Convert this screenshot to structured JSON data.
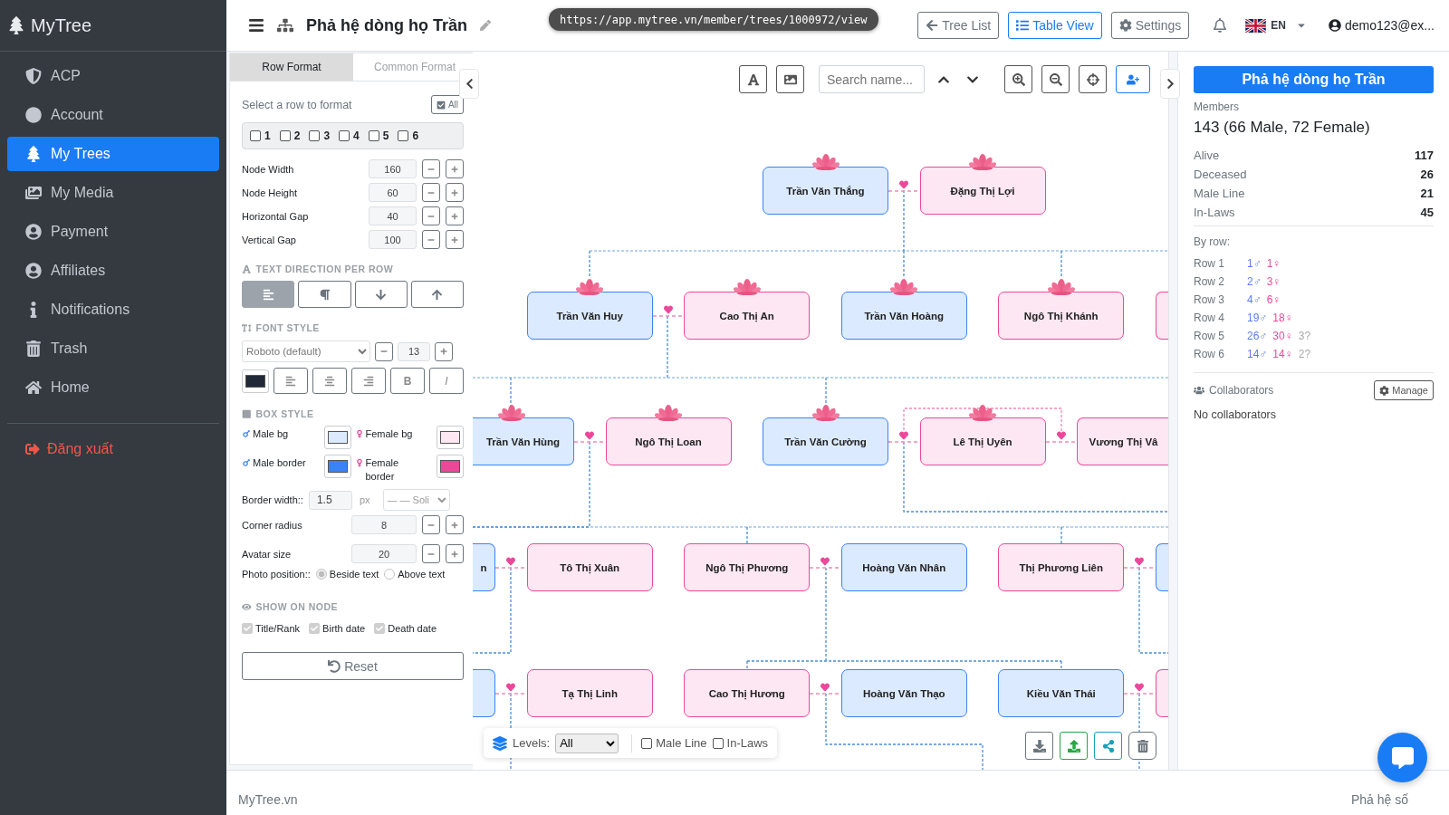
{
  "sidebar": {
    "brand": "MyTree",
    "items": [
      {
        "label": "ACP",
        "selected": false
      },
      {
        "label": "Account",
        "selected": false
      },
      {
        "label": "My Trees",
        "selected": true
      },
      {
        "label": "My Media",
        "selected": false
      },
      {
        "label": "Payment",
        "selected": false
      },
      {
        "label": "Affiliates",
        "selected": false
      },
      {
        "label": "Notifications",
        "selected": false
      },
      {
        "label": "Trash",
        "selected": false
      },
      {
        "label": "Home",
        "selected": false
      }
    ],
    "logout": "Đăng xuất"
  },
  "header": {
    "title": "Phả hệ dòng họ Trần",
    "url_tooltip": "https://app.mytree.vn/member/trees/1000972/view",
    "buttons": [
      {
        "label": "Tree List",
        "selected": false
      },
      {
        "label": "Table View",
        "selected": true
      },
      {
        "label": "Settings",
        "selected": false
      }
    ],
    "language": "EN",
    "user": "demo123@ex..."
  },
  "format_panel": {
    "tabs": [
      {
        "label": "Row Format",
        "selected": true
      },
      {
        "label": "Common Format",
        "selected": false
      }
    ],
    "row_select": {
      "label": "Select a row to format",
      "all_button": "All",
      "rows": [
        {
          "label": "1",
          "checked": false
        },
        {
          "label": "2",
          "checked": false
        },
        {
          "label": "3",
          "checked": false
        },
        {
          "label": "4",
          "checked": false
        },
        {
          "label": "5",
          "checked": false
        },
        {
          "label": "6",
          "checked": false
        }
      ]
    },
    "numeric_fields": [
      {
        "label": "Node Width",
        "value": "160"
      },
      {
        "label": "Node Height",
        "value": "60"
      },
      {
        "label": "Horizontal Gap",
        "value": "40"
      },
      {
        "label": "Vertical Gap",
        "value": "100"
      }
    ],
    "text_direction": {
      "title": "TEXT DIRECTION PER ROW",
      "options": [
        {
          "selected": true
        },
        {
          "selected": false
        },
        {
          "selected": false
        },
        {
          "selected": false
        }
      ]
    },
    "font_style": {
      "title": "FONT STYLE",
      "font": "Roboto (default)",
      "size": "13",
      "color": "#1f2937",
      "format_buttons": [
        "B",
        "I"
      ]
    },
    "box_style": {
      "title": "BOX STYLE",
      "swatches": [
        {
          "label": "Male bg",
          "kind": "male",
          "color": "#dbeafe"
        },
        {
          "label": "Female bg",
          "kind": "female",
          "color": "#fce7f3"
        },
        {
          "label": "Male border",
          "kind": "male",
          "color": "#3b82f6"
        },
        {
          "label": "Female border",
          "kind": "female",
          "color": "#ec4899"
        }
      ],
      "border_width": {
        "label": "Border width::",
        "value": "1.5",
        "unit": "px",
        "style": "— — Soli"
      },
      "steppers": [
        {
          "label": "Corner radius",
          "value": "8"
        },
        {
          "label": "Avatar size",
          "value": "20"
        }
      ],
      "photo_position": {
        "label": "Photo position::",
        "options": [
          {
            "label": "Beside text",
            "selected": true
          },
          {
            "label": "Above text",
            "selected": false
          }
        ]
      }
    },
    "show_on_node": {
      "title": "SHOW ON NODE",
      "options": [
        {
          "label": "Title/Rank",
          "checked": true
        },
        {
          "label": "Birth date",
          "checked": true
        },
        {
          "label": "Death date",
          "checked": true
        }
      ]
    },
    "reset": "Reset"
  },
  "canvas": {
    "search": {
      "placeholder": "Search name..."
    },
    "rows": [
      {
        "nodes": [
          {
            "name": "Trần Văn Thắng",
            "kind": "male",
            "lotus": true,
            "linked_to_next": true
          },
          {
            "name": "Đặng Thị Lợi",
            "kind": "female",
            "lotus": true,
            "linked_to_next": false
          }
        ]
      },
      {
        "nodes": [
          {
            "name": "Trần Văn Huy",
            "kind": "male",
            "lotus": true,
            "linked_to_next": true
          },
          {
            "name": "Cao Thị An",
            "kind": "female",
            "lotus": true,
            "linked_to_next": false
          },
          {
            "name": "Trần Văn Hoàng",
            "kind": "male",
            "lotus": true,
            "linked_to_next": false
          },
          {
            "name": "Ngô Thị Khánh",
            "kind": "female",
            "lotus": true,
            "linked_to_next": false
          },
          {
            "kind": "female",
            "linked_to_next": false
          }
        ]
      },
      {
        "nodes": [
          {
            "name": "Trần Văn Hùng",
            "kind": "male",
            "lotus": true,
            "linked_to_next": true
          },
          {
            "name": "Ngô Thị Loan",
            "kind": "female",
            "lotus": true,
            "linked_to_next": false
          },
          {
            "name": "Trần Văn Cường",
            "kind": "male",
            "lotus": true,
            "linked_to_next": true
          },
          {
            "name": "Lê Thị Uyên",
            "kind": "female",
            "lotus": true,
            "linked_to_next": true
          },
          {
            "name": "Vương Thị Vâ",
            "kind": "female",
            "lotus": false,
            "linked_to_next": false
          }
        ]
      },
      {
        "nodes": [
          {
            "name": "n",
            "kind": "male",
            "linked_to_next": true
          },
          {
            "name": "Tô Thị Xuân",
            "kind": "female",
            "lotus": false,
            "linked_to_next": false
          },
          {
            "name": "Ngô Thị Phương",
            "kind": "female",
            "lotus": false,
            "linked_to_next": true
          },
          {
            "name": "Hoàng Văn Nhân",
            "kind": "male",
            "lotus": false,
            "linked_to_next": false
          },
          {
            "name": "Thị Phương Liên",
            "kind": "female",
            "lotus": false,
            "linked_to_next": true
          },
          {
            "kind": "male",
            "linked_to_next": false
          }
        ]
      },
      {
        "nodes": [
          {
            "kind": "male",
            "linked_to_next": true
          },
          {
            "name": "Tạ Thị Linh",
            "kind": "female",
            "lotus": false,
            "linked_to_next": false
          },
          {
            "name": "Cao Thị Hương",
            "kind": "female",
            "lotus": false,
            "linked_to_next": true
          },
          {
            "name": "Hoàng Văn Thạo",
            "kind": "male",
            "lotus": false,
            "linked_to_next": false
          },
          {
            "name": "Kiều Văn Thái",
            "kind": "male",
            "lotus": false,
            "linked_to_next": true
          },
          {
            "kind": "female",
            "linked_to_next": false
          }
        ]
      }
    ],
    "levels": {
      "label": "Levels:",
      "value": "All"
    },
    "filters": [
      {
        "label": "Male Line",
        "checked": false
      },
      {
        "label": "In-Laws",
        "checked": false
      }
    ]
  },
  "summary": {
    "title": "Phả hệ dòng họ Trần",
    "members_label": "Members",
    "members": "143 (66 Male, 72 Female)",
    "stats": [
      {
        "label": "Alive",
        "value": "117"
      },
      {
        "label": "Deceased",
        "value": "26"
      },
      {
        "label": "Male Line",
        "value": "21"
      },
      {
        "label": "In-Laws",
        "value": "45"
      }
    ],
    "by_row_label": "By row:",
    "rows": [
      {
        "label": "Row 1",
        "male": "1♂",
        "female": "1♀"
      },
      {
        "label": "Row 2",
        "male": "2♂",
        "female": "3♀"
      },
      {
        "label": "Row 3",
        "male": "4♂",
        "female": "6♀"
      },
      {
        "label": "Row 4",
        "male": "19♂",
        "female": "18♀"
      },
      {
        "label": "Row 5",
        "male": "26♂",
        "female": "30♀",
        "unknown": "3?"
      },
      {
        "label": "Row 6",
        "male": "14♂",
        "female": "14♀",
        "unknown": "2?"
      }
    ],
    "collaborators": {
      "title": "Collaborators",
      "button": "Manage",
      "empty": "No collaborators"
    }
  },
  "footer": {
    "left": "MyTree.vn",
    "right": "Phả hệ số"
  }
}
